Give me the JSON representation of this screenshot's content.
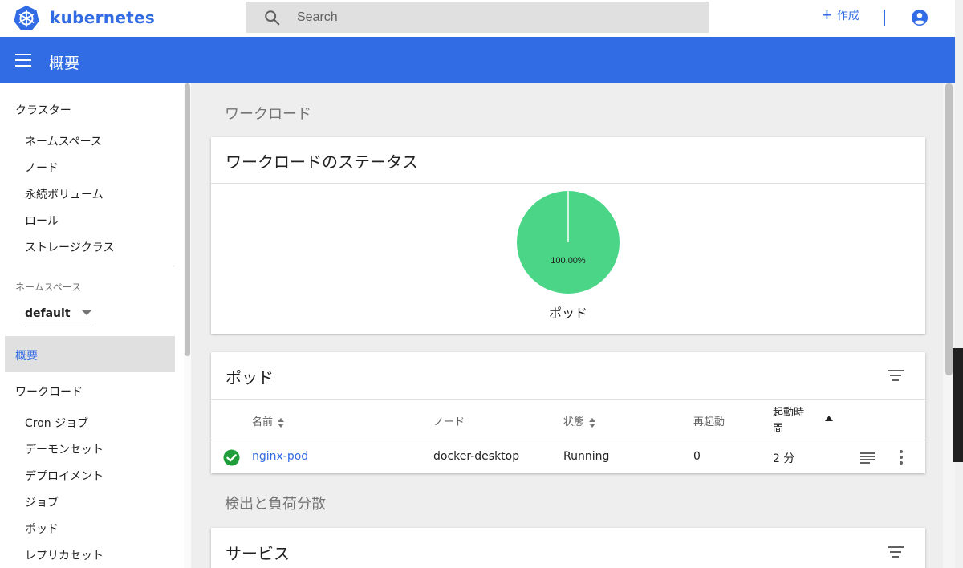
{
  "app": {
    "brand": "kubernetes"
  },
  "search": {
    "placeholder": "Search"
  },
  "actions": {
    "create_plus": "+",
    "create_label": "作成"
  },
  "header": {
    "title": "概要"
  },
  "sidebar": {
    "cluster_heading": "クラスター",
    "cluster_items": [
      "ネームスペース",
      "ノード",
      "永続ボリューム",
      "ロール",
      "ストレージクラス"
    ],
    "namespace_label": "ネームスペース",
    "namespace_value": "default",
    "active_item": "概要",
    "workload_heading": "ワークロード",
    "workload_items": [
      "Cron ジョブ",
      "デーモンセット",
      "デプロイメント",
      "ジョブ",
      "ポッド",
      "レプリカセット"
    ]
  },
  "main": {
    "section_workloads": "ワークロード",
    "status_card": {
      "title": "ワークロードのステータス"
    },
    "pods_card": {
      "title": "ポッド",
      "columns": {
        "name": "名前",
        "node": "ノード",
        "status": "状態",
        "restarts": "再起動",
        "age": "起動時間"
      },
      "rows": [
        {
          "name": "nginx-pod",
          "node": "docker-desktop",
          "status": "Running",
          "restarts": "0",
          "age": "2 分"
        }
      ]
    },
    "section_discovery": "検出と負荷分散",
    "services_card": {
      "title": "サービス"
    }
  },
  "chart_data": {
    "type": "pie",
    "slices": [
      {
        "label": "ポッド",
        "value": 100.0,
        "display": "100.00%",
        "color": "#4ad686"
      }
    ],
    "legend": "ポッド"
  },
  "colors": {
    "accent": "#326ce5",
    "success": "#4ad686",
    "ok_icon": "#1f9d3a"
  },
  "icons": [
    "kubernetes-logo",
    "search-icon",
    "account-icon",
    "menu-icon",
    "filter-icon",
    "check-circle-icon",
    "logs-icon",
    "more-vert-icon"
  ]
}
